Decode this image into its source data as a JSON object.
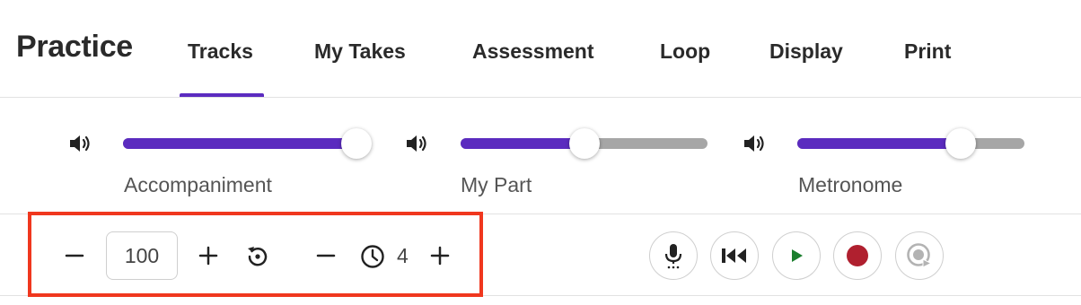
{
  "header": {
    "title": "Practice",
    "tabs": [
      {
        "label": "Tracks",
        "selected": true
      },
      {
        "label": "My Takes"
      },
      {
        "label": "Assessment"
      },
      {
        "label": "Loop"
      },
      {
        "label": "Display"
      },
      {
        "label": "Print"
      }
    ]
  },
  "mixer": {
    "tracks": [
      {
        "label": "Accompaniment",
        "level_percent": 100,
        "icon": "volume-icon"
      },
      {
        "label": "My Part",
        "level_percent": 50,
        "icon": "volume-icon"
      },
      {
        "label": "Metronome",
        "level_percent": 72,
        "icon": "volume-icon"
      }
    ]
  },
  "controls": {
    "tempo_value": "100",
    "count_in_value": "4",
    "icons": [
      "minus-icon",
      "plus-icon",
      "reset-icon",
      "clock-icon",
      "microphone-icon",
      "skip-to-start-icon",
      "play-icon",
      "record-icon",
      "record-playback-icon"
    ]
  },
  "colors": {
    "accent": "#5b2bbf",
    "play": "#1b7f2e",
    "record": "#b0202f",
    "highlight": "#f0371e"
  }
}
